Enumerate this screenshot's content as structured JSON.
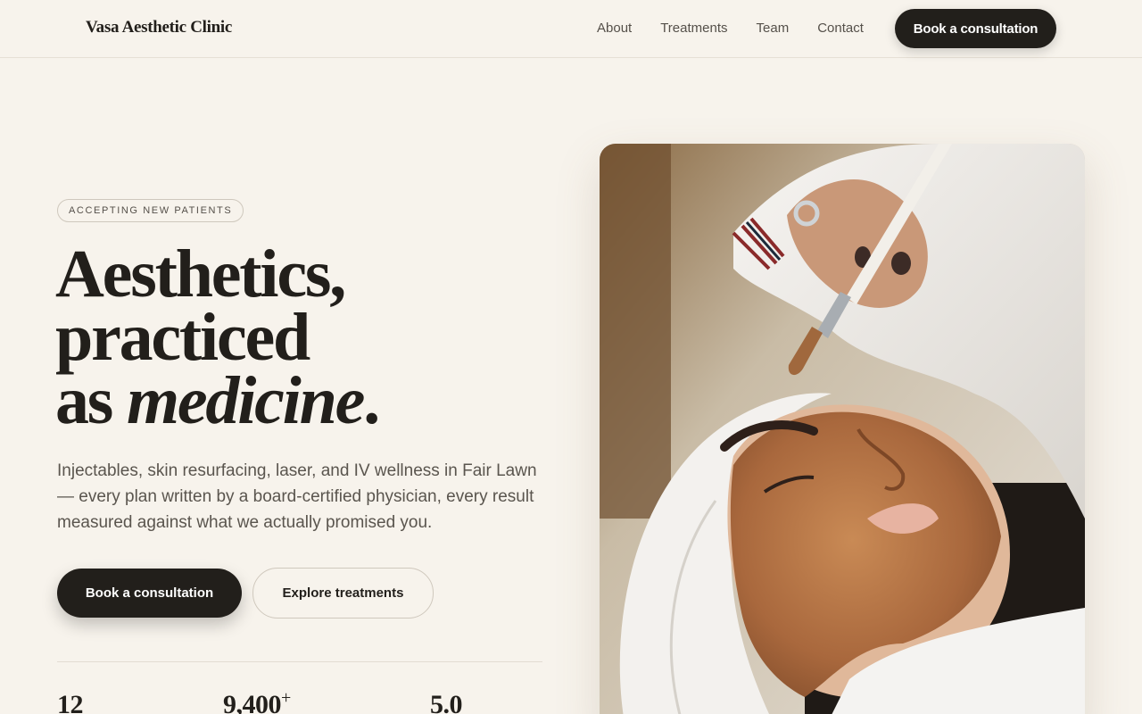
{
  "header": {
    "brand": "Vasa Aesthetic Clinic",
    "nav": [
      "About",
      "Treatments",
      "Team",
      "Contact"
    ],
    "cta": "Book a consultation"
  },
  "hero": {
    "badge": "ACCEPTING NEW PATIENTS",
    "headline_line1": "Aesthetics,",
    "headline_line2": "practiced",
    "headline_line3_plain": "as ",
    "headline_line3_italic": "medicine",
    "headline_line3_end": ".",
    "lede": "Injectables, skin resurfacing, laser, and IV wellness in Fair Lawn — every plan written by a board-certified physician, every result measured against what we actually promised you.",
    "primary_cta": "Book a consultation",
    "secondary_cta": "Explore treatments"
  },
  "stats": [
    {
      "value": "12",
      "suffix": ""
    },
    {
      "value": "9,400",
      "suffix": "+"
    },
    {
      "value": "5.0",
      "suffix": ""
    }
  ],
  "image": {
    "subject": "clinician applying clay facial mask with brush to reclining patient"
  }
}
